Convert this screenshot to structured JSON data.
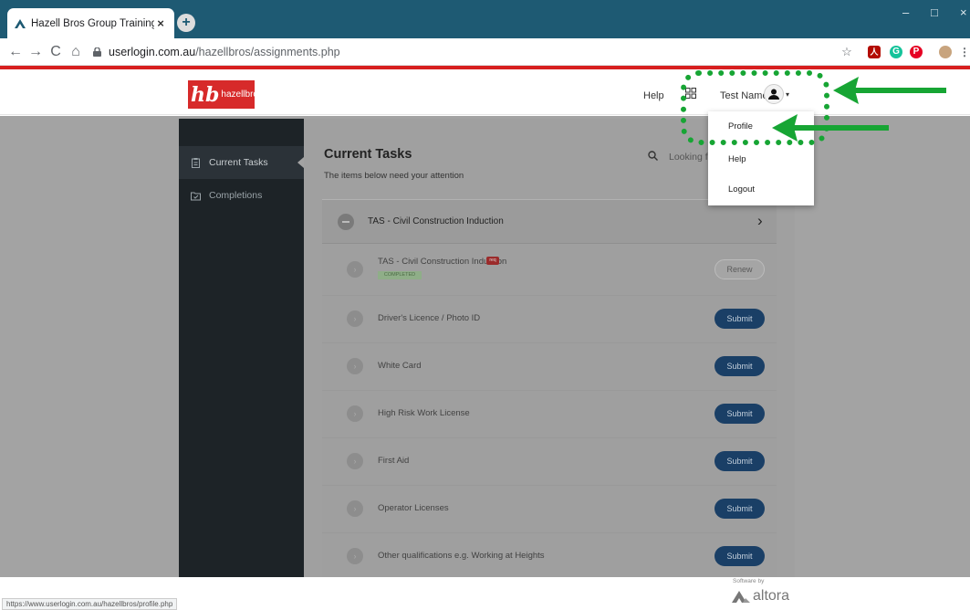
{
  "browser": {
    "tab_title": "Hazell Bros Group Training Platfo",
    "new_tab": "+",
    "close_tab": "×",
    "url_host": "userlogin.com.au",
    "url_path": "/hazellbros/assignments.php",
    "window_controls": [
      "–",
      "□",
      "×"
    ],
    "extensions": [
      {
        "name": "star-icon",
        "glyph": "☆",
        "color": "#5f6368"
      },
      {
        "name": "pdf-extension-icon",
        "glyph": "人",
        "color": "#b30b00"
      },
      {
        "name": "grammarly-icon",
        "glyph": "G",
        "color": "#15c39a"
      },
      {
        "name": "pinterest-icon",
        "glyph": "P",
        "color": "#e60023"
      }
    ],
    "status_url": "https://www.userlogin.com.au/hazellbros/profile.php"
  },
  "header": {
    "logo_mark": "hb",
    "logo_word": "hazellbros",
    "help_label": "Help",
    "user_name": "Test Name",
    "caret": "▾"
  },
  "sidebar": {
    "items": [
      {
        "label": "Current Tasks",
        "icon": "clipboard-icon",
        "active": true
      },
      {
        "label": "Completions",
        "icon": "folder-check-icon",
        "active": false
      }
    ]
  },
  "main": {
    "title": "Current Tasks",
    "subtitle": "The items below need your attention",
    "search_placeholder": "Looking fo",
    "section_label": "TAS - Civil Construction Induction",
    "tasks": [
      {
        "label": "TAS - Civil Construction Induction",
        "action": "Renew",
        "badge": "req",
        "status": "COMPLETED"
      },
      {
        "label": "Driver's Licence / Photo ID",
        "action": "Submit"
      },
      {
        "label": "White Card",
        "action": "Submit"
      },
      {
        "label": "High Risk Work License",
        "action": "Submit"
      },
      {
        "label": "First Aid",
        "action": "Submit"
      },
      {
        "label": "Operator Licenses",
        "action": "Submit"
      },
      {
        "label": "Other qualifications e.g. Working at Heights",
        "action": "Submit"
      }
    ]
  },
  "dropdown": {
    "items": [
      "Profile",
      "Help",
      "Logout"
    ]
  },
  "footer": {
    "software_by": "Software by",
    "brand": "altora"
  },
  "colors": {
    "tabbar": "#1e5a73",
    "brand_red": "#d71f1f",
    "submit_blue": "#1a3f66",
    "highlight_green": "#17a534"
  }
}
